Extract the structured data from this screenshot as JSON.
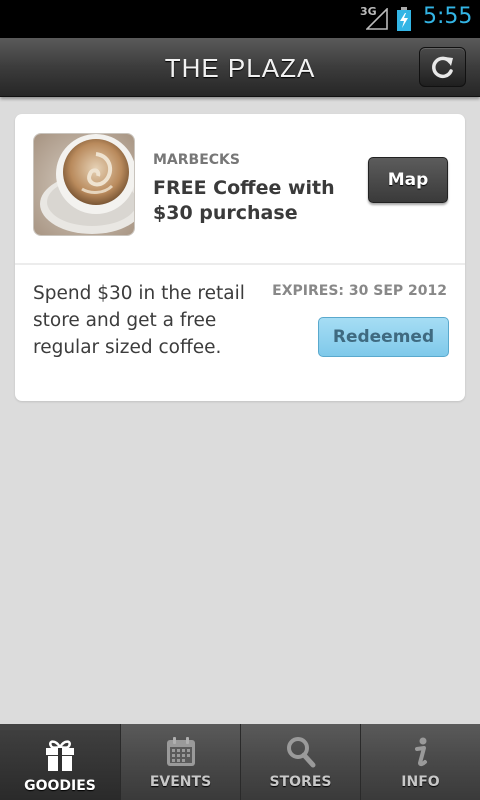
{
  "status_bar": {
    "network": "3G",
    "time": "5:55"
  },
  "header": {
    "title": "THE PLAZA",
    "refresh_icon": "refresh-icon"
  },
  "offer": {
    "store": "MARBECKS",
    "title": "FREE Coffee with $30 purchase",
    "map_label": "Map",
    "description": "Spend $30 in the retail store and get a free regular sized coffee.",
    "expires": "EXPIRES: 30 SEP 2012",
    "status_label": "Redeemed"
  },
  "nav": {
    "tabs": [
      {
        "label": "GOODIES",
        "icon": "gift-icon",
        "active": true
      },
      {
        "label": "EVENTS",
        "icon": "calendar-icon",
        "active": false
      },
      {
        "label": "STORES",
        "icon": "search-icon",
        "active": false
      },
      {
        "label": "INFO",
        "icon": "info-icon",
        "active": false
      }
    ]
  },
  "colors": {
    "accent": "#33b5e5",
    "redeemed_bg": "#90d3ef",
    "card_bg": "#ffffff",
    "page_bg": "#dcdcdc"
  }
}
